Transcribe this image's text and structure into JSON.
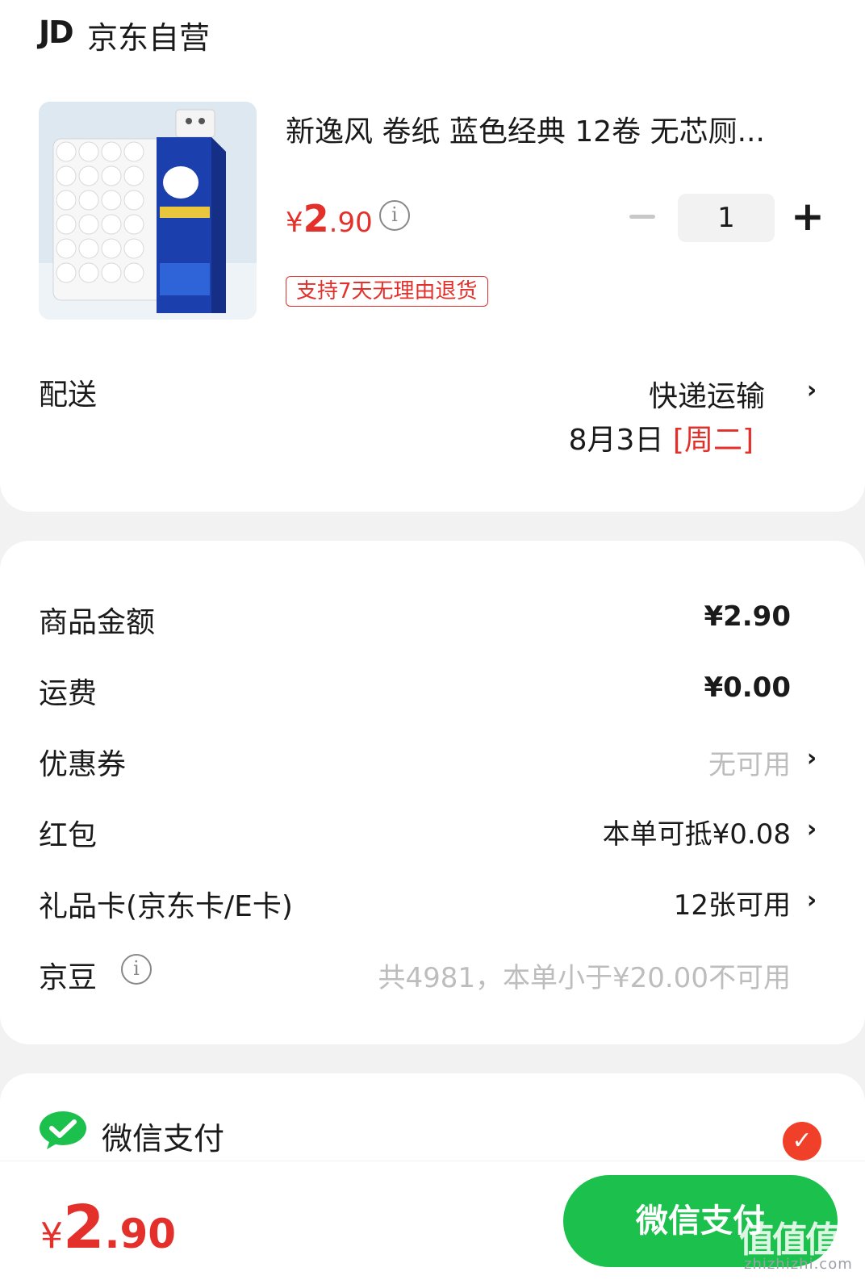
{
  "header": {
    "logo": "JD",
    "store": "京东自营"
  },
  "product": {
    "title": "新逸风 卷纸 蓝色经典 12卷 无芯厕...",
    "price_symbol": "¥",
    "price_int": "2",
    "price_cents": ".90",
    "info_icon": "i",
    "quantity": "1",
    "minus_icon": "minus",
    "plus_icon": "+",
    "return_badge": "支持7天无理由退货"
  },
  "delivery": {
    "label": "配送",
    "method": "快递运输",
    "date": "8月3日 ",
    "weekday": "[周二]",
    "chevron": "›"
  },
  "cost": {
    "items": [
      {
        "label": "商品金额",
        "value": "¥2.90"
      },
      {
        "label": "运费",
        "value": "¥0.00"
      },
      {
        "label": "优惠券",
        "value": "无可用"
      },
      {
        "label": "红包",
        "value": "本单可抵¥0.08"
      },
      {
        "label": "礼品卡(京东卡/E卡)",
        "value": "12张可用"
      },
      {
        "label": "京豆",
        "value": "共4981，本单小于¥20.00不可用"
      }
    ],
    "chevron": "›",
    "info_icon": "i"
  },
  "payment": {
    "method": "微信支付",
    "check": "✓",
    "total_symbol": "¥",
    "total_int": "2",
    "total_cents": ".90",
    "pay_button": "微信支付"
  },
  "watermark": {
    "main": "值值值",
    "sub": "zhizhizhi.com"
  },
  "colors": {
    "accent_red": "#e4302b",
    "wechat_green": "#1bc14c",
    "background": "#f2f2f2"
  }
}
